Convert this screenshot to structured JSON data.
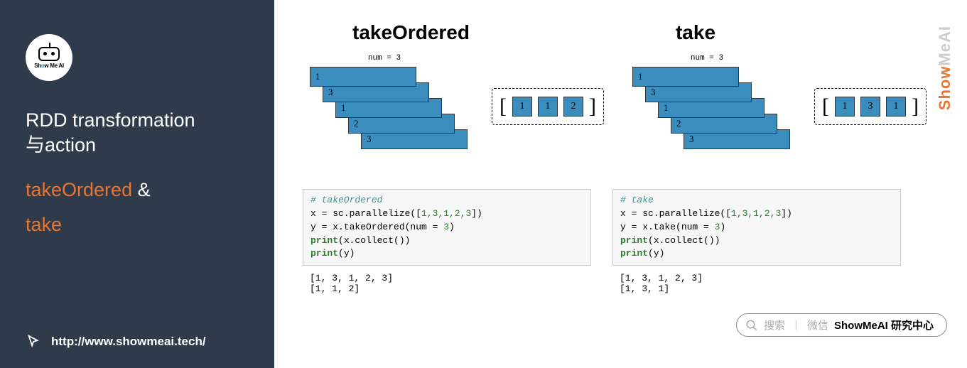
{
  "sidebar": {
    "logo_text_parts": [
      "Sh",
      "o",
      "w Me AI"
    ],
    "title_line1": "RDD transformation",
    "title_line2": "与action",
    "subtitle1_a": "takeOrdered",
    "subtitle1_amp": " &",
    "subtitle2": "take",
    "url": "http://www.showmeai.tech/"
  },
  "main": {
    "heading_left": "takeOrdered",
    "heading_right": "take",
    "num_label": "num = 3",
    "left": {
      "partitions": [
        "1",
        "3",
        "1",
        "2",
        "3"
      ],
      "result": [
        "1",
        "1",
        "2"
      ]
    },
    "right": {
      "partitions": [
        "1",
        "3",
        "1",
        "2",
        "3"
      ],
      "result": [
        "1",
        "3",
        "1"
      ]
    },
    "code_left": {
      "comment": "# takeOrdered",
      "line1a": "x = sc.parallelize([",
      "nums1": "1,3,1,2,3",
      "line1b": "])",
      "line2a": "y = x.takeOrdered(num = ",
      "num2": "3",
      "line2b": ")",
      "line3a": "print",
      "line3b": "(x.collect())",
      "line4a": "print",
      "line4b": "(y)",
      "out1": "[1, 3, 1, 2, 3]",
      "out2": "[1, 1, 2]"
    },
    "code_right": {
      "comment": "# take",
      "line1a": "x = sc.parallelize([",
      "nums1": "1,3,1,2,3",
      "line1b": "])",
      "line2a": "y = x.take(num = ",
      "num2": "3",
      "line2b": ")",
      "line3a": "print",
      "line3b": "(x.collect())",
      "line4a": "print",
      "line4b": "(y)",
      "out1": "[1, 3, 1, 2, 3]",
      "out2": "[1, 3, 1]"
    }
  },
  "watermark_a": "MeAI",
  "watermark_b": "Show",
  "search": {
    "icon": "search-icon",
    "hint": "搜索",
    "div": "丨",
    "wechat": "微信",
    "bold": "ShowMeAI 研究中心"
  }
}
